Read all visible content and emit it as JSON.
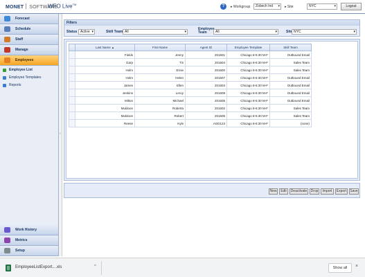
{
  "header": {
    "brand_main": "MONET",
    "brand_sub": "SOFTWARE",
    "app_title": "WFO Live",
    "app_title_tm": "TM",
    "help_label": "?",
    "workgroup_label": "Workgroup",
    "workgroup_value": "Zobech Ind",
    "site_label": "Site",
    "site_value": "NYC",
    "logout_label": "Logout"
  },
  "sidebar": {
    "top_items": [
      {
        "label": "Forecast",
        "icon": "forecast-icon"
      },
      {
        "label": "Schedule",
        "icon": "schedule-icon"
      },
      {
        "label": "Staff",
        "icon": "staff-icon"
      },
      {
        "label": "Manage",
        "icon": "manage-icon"
      },
      {
        "label": "Employees",
        "icon": "employees-icon",
        "active": true
      }
    ],
    "sub_items": [
      {
        "label": "Employee List",
        "selected": true
      },
      {
        "label": "Employee Templates"
      },
      {
        "label": "Reports"
      }
    ],
    "bottom_items": [
      {
        "label": "Work History"
      },
      {
        "label": "Metrics"
      },
      {
        "label": "Setup"
      }
    ]
  },
  "filters": {
    "title": "Filters",
    "status_label": "Status",
    "status_value": "Active",
    "skill_team_label": "Skill Team",
    "skill_team_value": "All",
    "employee_team_label": "Employee Team",
    "employee_team_value": "All",
    "site_label": "Site",
    "site_value": "NYC"
  },
  "grid": {
    "columns": [
      "Last Name",
      "First Name",
      "Agent ID",
      "Employee Template",
      "Skill Team"
    ],
    "sort_indicator": "▲",
    "rows": [
      [
        "Fields",
        "Jenny",
        "201601",
        "Chicago 8-5:30 M-F",
        "Outbound Email"
      ],
      [
        "Garp",
        "TS",
        "201604",
        "Chicago 8-5:30 M-F",
        "Sales Team"
      ],
      [
        "Holm",
        "Ernie",
        "201600",
        "Chicago 8-5:30 M-F",
        "Sales Team"
      ],
      [
        "Holm",
        "Helen",
        "201607",
        "Chicago 8-5:30 M-F",
        "Outbound Email"
      ],
      [
        "James",
        "Ellen",
        "201603",
        "Chicago 8-5:30 M-F",
        "Outbound Email"
      ],
      [
        "Jenkins",
        "Leroy",
        "201608",
        "Chicago 8-5:30 M-F",
        "Outbound Email"
      ],
      [
        "Milton",
        "Michael",
        "201605",
        "Chicago 8-5:30 M-F",
        "Outbound Email"
      ],
      [
        "Muldoon",
        "Roberta",
        "201602",
        "Chicago 8-5:30 M-F",
        "Sales Team"
      ],
      [
        "Muldoon",
        "Robert",
        "201606",
        "Chicago 8-5:30 M-F",
        "Sales Team"
      ],
      [
        "Reese",
        "Kyle",
        "AGD123",
        "Chicago 8-5:30 M-F",
        "(none)"
      ]
    ]
  },
  "actions": [
    "New",
    "Edit",
    "Deactivate",
    "Drop",
    "Import",
    "Export",
    "Save"
  ],
  "download_bar": {
    "file_name": "EmployeeListExport....xls",
    "caret": "^",
    "show_all": "Show all",
    "close": "×"
  },
  "colors": {
    "accent": "#f5a623",
    "nav_blue": "#c5d3ea",
    "excel_green": "#1f7244"
  }
}
